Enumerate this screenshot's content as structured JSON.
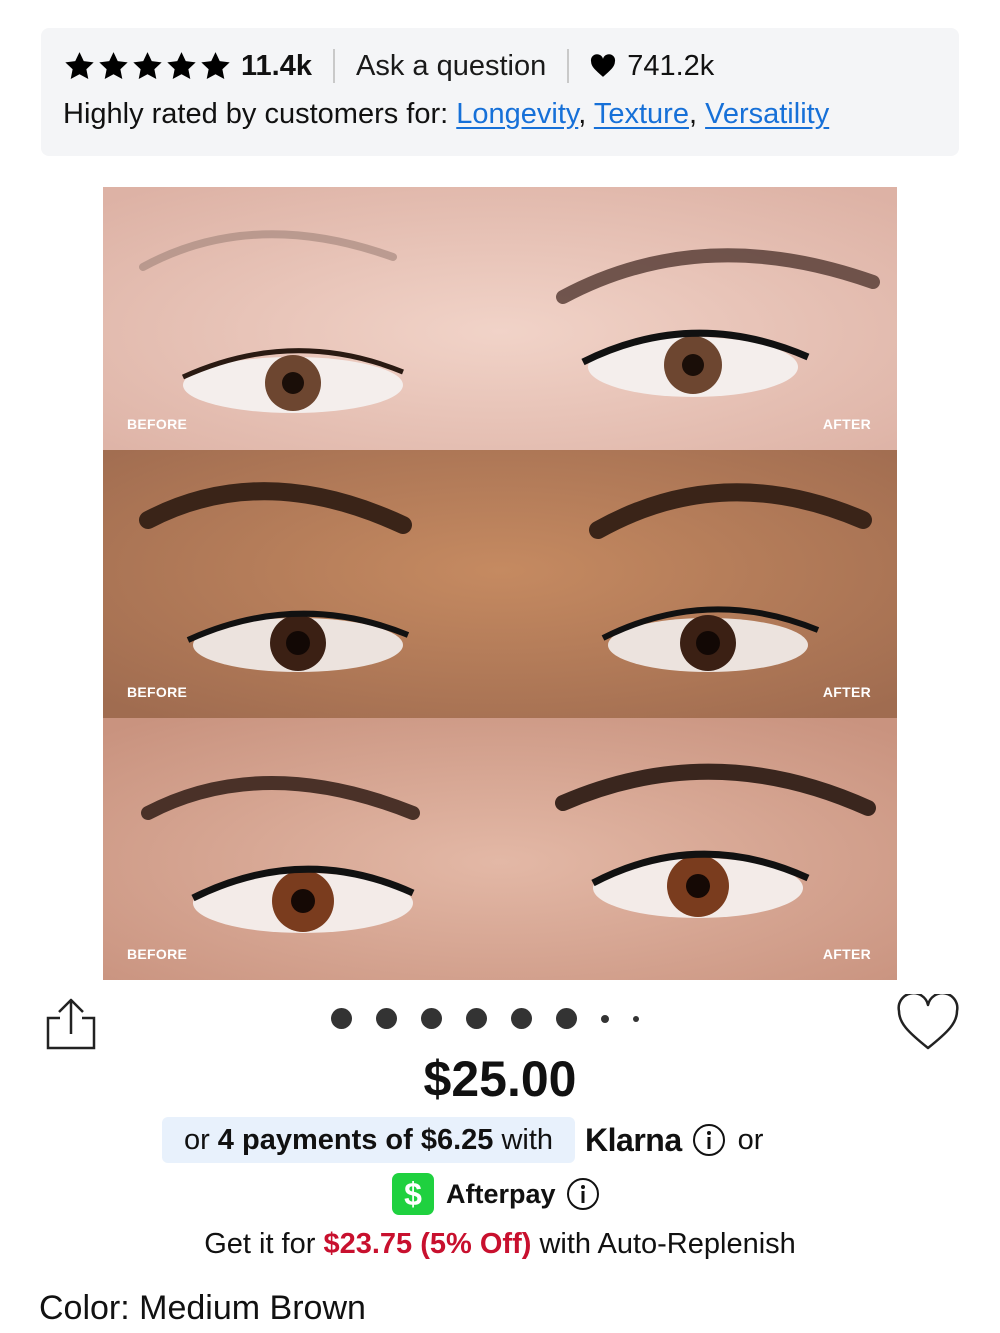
{
  "rating": {
    "stars": 5,
    "count": "11.4k",
    "ask_label": "Ask a question",
    "loves": "741.2k",
    "highly_rated_prefix": "Highly rated by customers for:",
    "attributes": [
      "Longevity",
      "Texture",
      "Versatility"
    ]
  },
  "hero": {
    "panels": [
      {
        "before_label": "BEFORE",
        "after_label": "AFTER"
      },
      {
        "before_label": "BEFORE",
        "after_label": "AFTER"
      },
      {
        "before_label": "BEFORE",
        "after_label": "AFTER"
      }
    ]
  },
  "carousel": {
    "dot_count": 8,
    "active_index": 0
  },
  "price": "$25.00",
  "klarna": {
    "prefix": "or",
    "payments": "4 payments of $6.25",
    "suffix": "with",
    "logo_text": "Klarna",
    "trailing": "or"
  },
  "afterpay": {
    "icon_text": "$",
    "label": "Afterpay"
  },
  "auto_replenish": {
    "prefix": "Get it for",
    "sale_price": "$23.75 (5% Off)",
    "suffix": "with Auto-Replenish"
  },
  "color": {
    "label": "Color:",
    "value": "Medium Brown"
  },
  "colors": {
    "link_blue": "#1670d8",
    "sale_red": "#c8102e",
    "klarna_pill_bg": "#e8f1fc",
    "cash_app_green": "#1fd13f"
  }
}
